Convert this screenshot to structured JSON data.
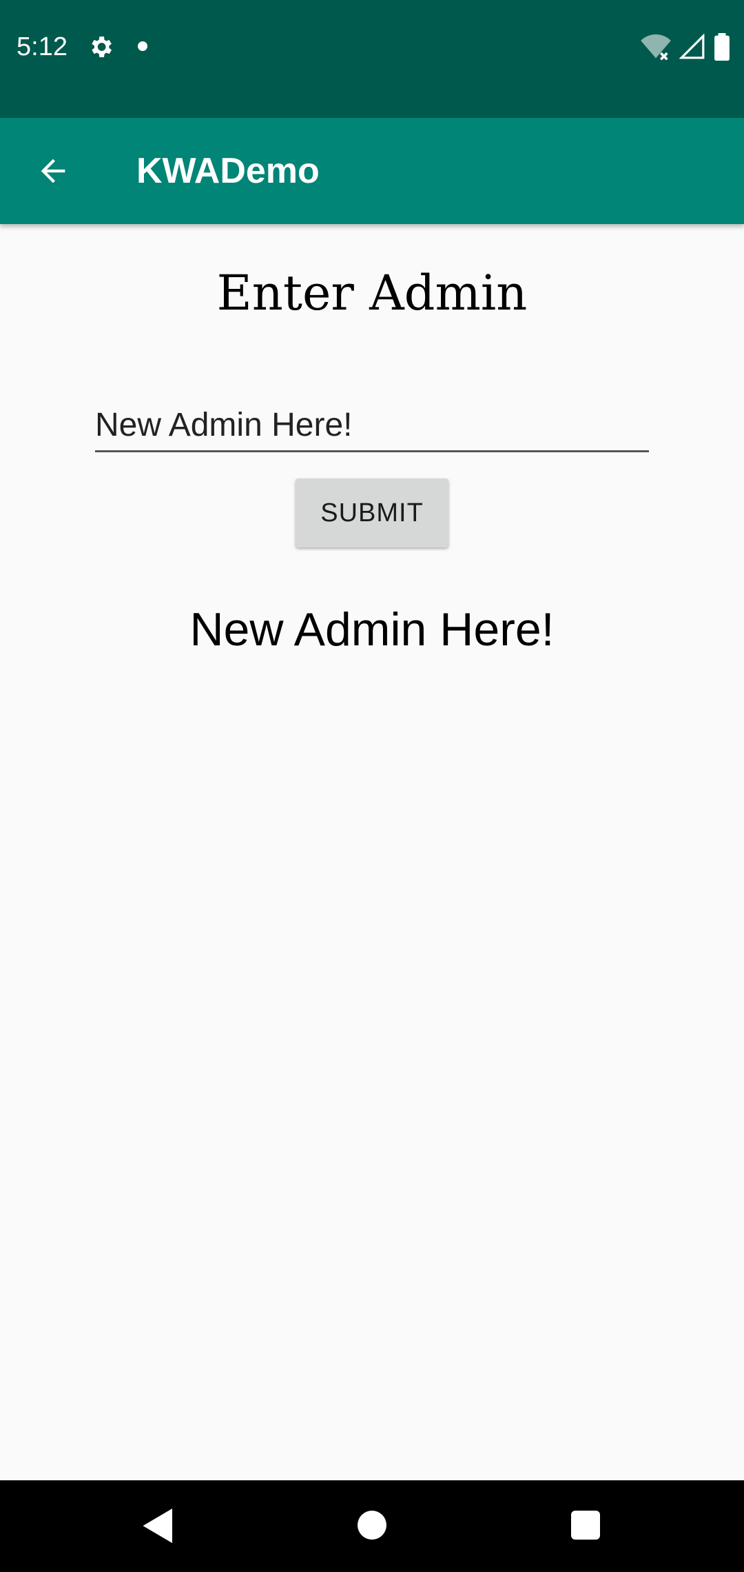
{
  "status_bar": {
    "time": "5:12",
    "icons": [
      "settings-gear-icon",
      "notification-dot-icon",
      "wifi-icon",
      "signal-icon",
      "battery-icon"
    ]
  },
  "app_bar": {
    "title": "KWADemo",
    "back_icon": "arrow-back-icon"
  },
  "content": {
    "heading": "Enter Admin",
    "admin_input": {
      "value": "New Admin Here!"
    },
    "submit_label": "SUBMIT",
    "result_text": "New Admin Here!"
  },
  "nav_bar": {
    "icons": [
      "back-triangle-icon",
      "home-circle-icon",
      "recents-square-icon"
    ]
  },
  "colors": {
    "status_bar": "#00594d",
    "app_bar": "#008577",
    "background": "#fafafa",
    "button": "#d6d7d7",
    "nav_bar": "#000000"
  }
}
